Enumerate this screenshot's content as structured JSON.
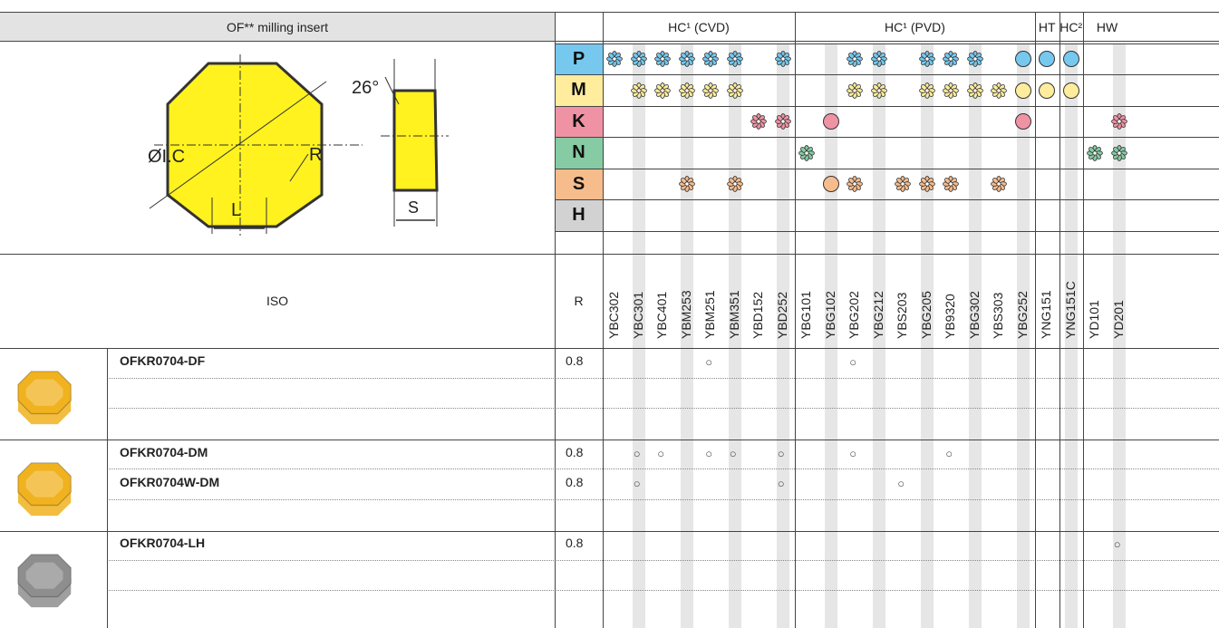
{
  "header": {
    "title": "OF** milling insert",
    "groups": [
      {
        "label": "HC¹ (CVD)"
      },
      {
        "label": "HC¹ (PVD)"
      },
      {
        "label": "HT"
      },
      {
        "label": "HC²"
      },
      {
        "label": "HW"
      }
    ]
  },
  "diagram": {
    "angle_label": "26°",
    "diameter_label": "ØI.C",
    "radius_label": "R",
    "length_label": "L",
    "thickness_label": "S"
  },
  "materials": [
    {
      "letter": "P",
      "color": "#76c8ee"
    },
    {
      "letter": "M",
      "color": "#ffec9c"
    },
    {
      "letter": "K",
      "color": "#ef93a4"
    },
    {
      "letter": "N",
      "color": "#86cba3"
    },
    {
      "letter": "S",
      "color": "#f7bc8c"
    },
    {
      "letter": "H",
      "color": "#d2d2d2"
    }
  ],
  "suitability_legend": {
    "flower": "multi-petal symbol",
    "circle": "circle symbol"
  },
  "iso_label": "ISO",
  "r_label": "R",
  "grades": [
    "YBC302",
    "YBC301",
    "YBC401",
    "YBM253",
    "YBM251",
    "YBM351",
    "YBD152",
    "YBD252",
    "YBG101",
    "YBG102",
    "YBG202",
    "YBG212",
    "YBS203",
    "YBG205",
    "YB9320",
    "YBG302",
    "YBS303",
    "YBG252",
    "YNG151",
    "YNG151C",
    "YD101",
    "YD201"
  ],
  "suitability": {
    "P": [
      [
        "flower",
        "YBC302"
      ],
      [
        "flower",
        "YBC301"
      ],
      [
        "flower",
        "YBC401"
      ],
      [
        "flower",
        "YBM253"
      ],
      [
        "flower",
        "YBM251"
      ],
      [
        "flower",
        "YBM351"
      ],
      [
        "flower",
        "YBD252"
      ],
      [
        "flower",
        "YBG202"
      ],
      [
        "flower",
        "YBG212"
      ],
      [
        "flower",
        "YBG205"
      ],
      [
        "flower",
        "YB9320"
      ],
      [
        "flower",
        "YBG302"
      ],
      [
        "circle",
        "YBG252"
      ],
      [
        "circle",
        "YNG151"
      ],
      [
        "circle",
        "YNG151C"
      ]
    ],
    "M": [
      [
        "flower",
        "YBC301"
      ],
      [
        "flower",
        "YBC401"
      ],
      [
        "flower",
        "YBM253"
      ],
      [
        "flower",
        "YBM251"
      ],
      [
        "flower",
        "YBM351"
      ],
      [
        "flower",
        "YBG202"
      ],
      [
        "flower",
        "YBG212"
      ],
      [
        "flower",
        "YBG205"
      ],
      [
        "flower",
        "YB9320"
      ],
      [
        "flower",
        "YBG302"
      ],
      [
        "flower",
        "YBS303"
      ],
      [
        "circle",
        "YBG252"
      ],
      [
        "circle",
        "YNG151"
      ],
      [
        "circle",
        "YNG151C"
      ]
    ],
    "K": [
      [
        "flower",
        "YBD152"
      ],
      [
        "flower",
        "YBD252"
      ],
      [
        "circle",
        "YBG102"
      ],
      [
        "circle",
        "YBG252"
      ],
      [
        "flower",
        "YD201"
      ]
    ],
    "N": [
      [
        "flower",
        "YBG101"
      ],
      [
        "flower",
        "YD101"
      ],
      [
        "flower",
        "YD201"
      ]
    ],
    "S": [
      [
        "flower",
        "YBM253"
      ],
      [
        "flower",
        "YBM351"
      ],
      [
        "circle",
        "YBG102"
      ],
      [
        "flower",
        "YBG202"
      ],
      [
        "flower",
        "YBS203"
      ],
      [
        "flower",
        "YBG205"
      ],
      [
        "flower",
        "YB9320"
      ],
      [
        "flower",
        "YBS303"
      ]
    ],
    "H": []
  },
  "products": [
    {
      "name": "OFKR0704-DF",
      "r": "0.8",
      "marks": [
        "YBM251",
        "YBG202"
      ]
    },
    {
      "name": "",
      "r": "",
      "marks": []
    },
    {
      "name": "",
      "r": "",
      "marks": []
    },
    {
      "name": "OFKR0704-DM",
      "r": "0.8",
      "marks": [
        "YBC301",
        "YBC401",
        "YBM251",
        "YBM351",
        "YBD252",
        "YBG202",
        "YB9320"
      ]
    },
    {
      "name": "OFKR0704W-DM",
      "r": "0.8",
      "marks": [
        "YBC301",
        "YBD252",
        "YBS203"
      ]
    },
    {
      "name": "",
      "r": "",
      "marks": []
    },
    {
      "name": "OFKR0704-LH",
      "r": "0.8",
      "marks": [
        "YD201"
      ]
    },
    {
      "name": "",
      "r": "",
      "marks": []
    },
    {
      "name": "",
      "r": "",
      "marks": []
    }
  ],
  "mark_symbol": "○",
  "insert_images": [
    {
      "name": "gold insert DF",
      "color": "#f0b21e"
    },
    {
      "name": "gold insert DM",
      "color": "#f0b21e"
    },
    {
      "name": "grey insert LH",
      "color": "#8e8e8e"
    }
  ]
}
